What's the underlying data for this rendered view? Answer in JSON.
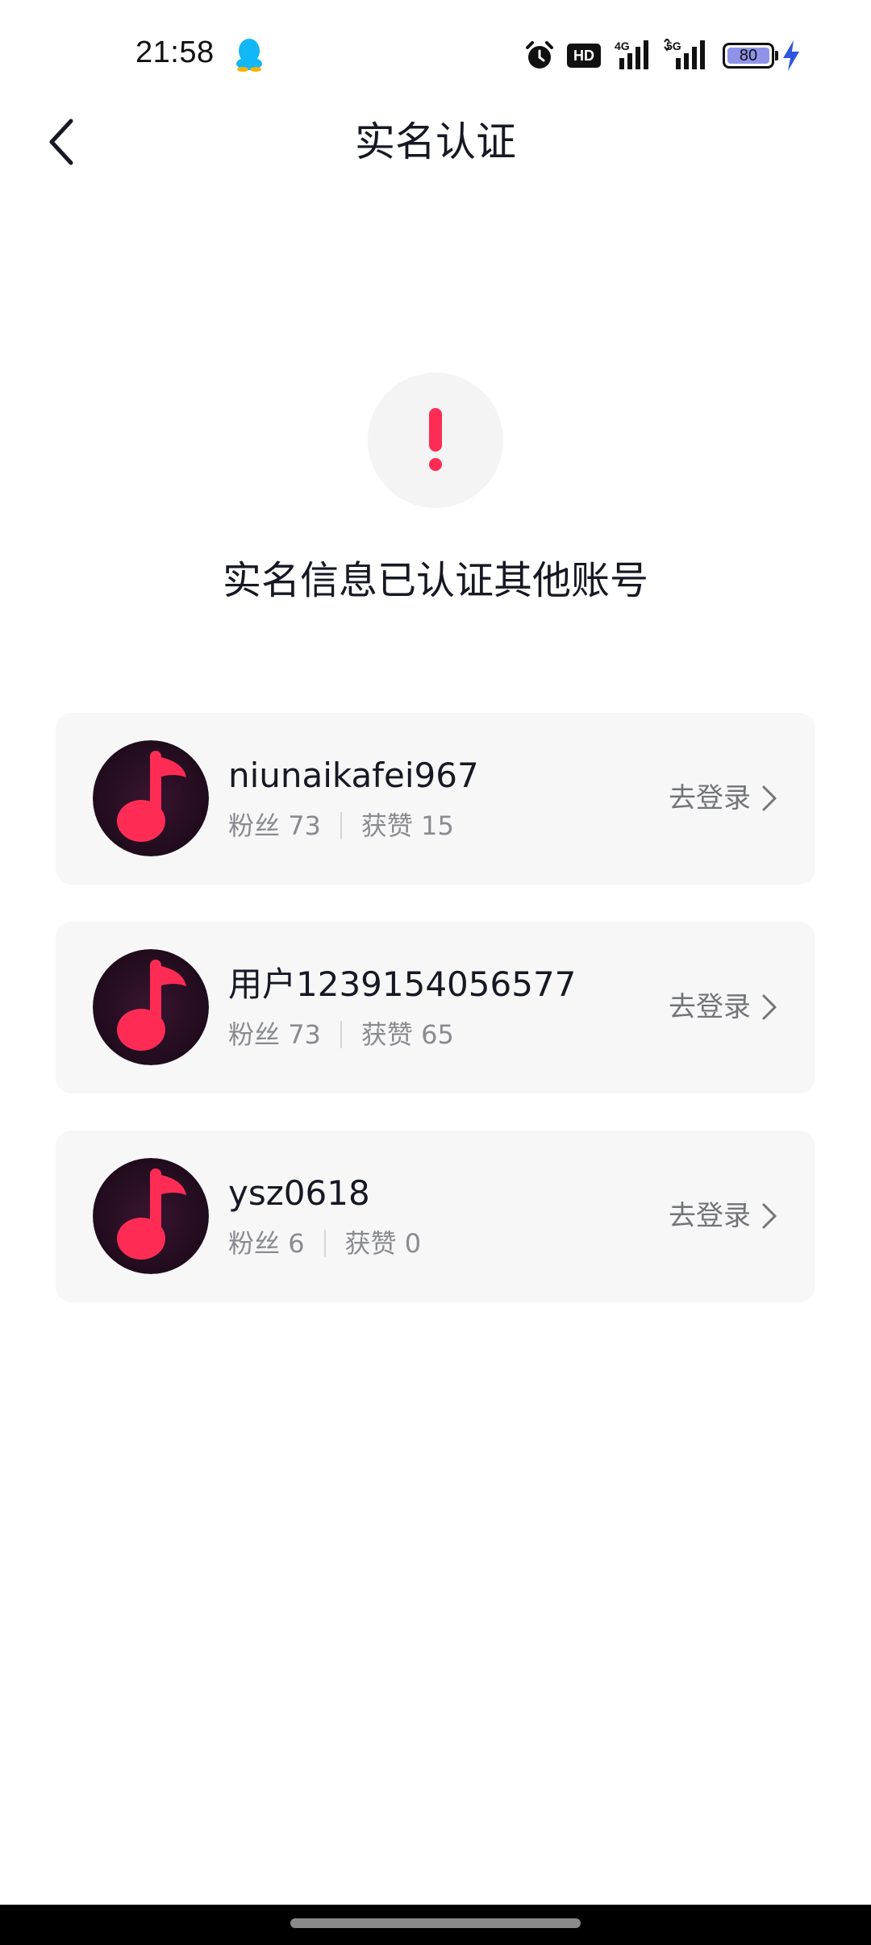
{
  "status_bar": {
    "time": "21:58",
    "hd_label": "HD",
    "battery_level": "80",
    "icons": [
      "qq-icon",
      "alarm-icon",
      "hd-icon",
      "signal-4g-icon",
      "signal-5g-icon",
      "battery-icon",
      "charging-bolt-icon"
    ]
  },
  "header": {
    "title": "实名认证",
    "back_icon": "chevron-left-icon"
  },
  "alert": {
    "icon": "exclamation-icon",
    "message": "实名信息已认证其他账号",
    "accent_color": "#fe2c55"
  },
  "accounts": [
    {
      "name": "niunaikafei967",
      "fans_label": "粉丝",
      "fans": "73",
      "likes_label": "获赞",
      "likes": "15",
      "action": "去登录"
    },
    {
      "name": "用户1239154056577",
      "fans_label": "粉丝",
      "fans": "73",
      "likes_label": "获赞",
      "likes": "65",
      "action": "去登录"
    },
    {
      "name": "ysz0618",
      "fans_label": "粉丝",
      "fans": "6",
      "likes_label": "获赞",
      "likes": "0",
      "action": "去登录"
    }
  ]
}
